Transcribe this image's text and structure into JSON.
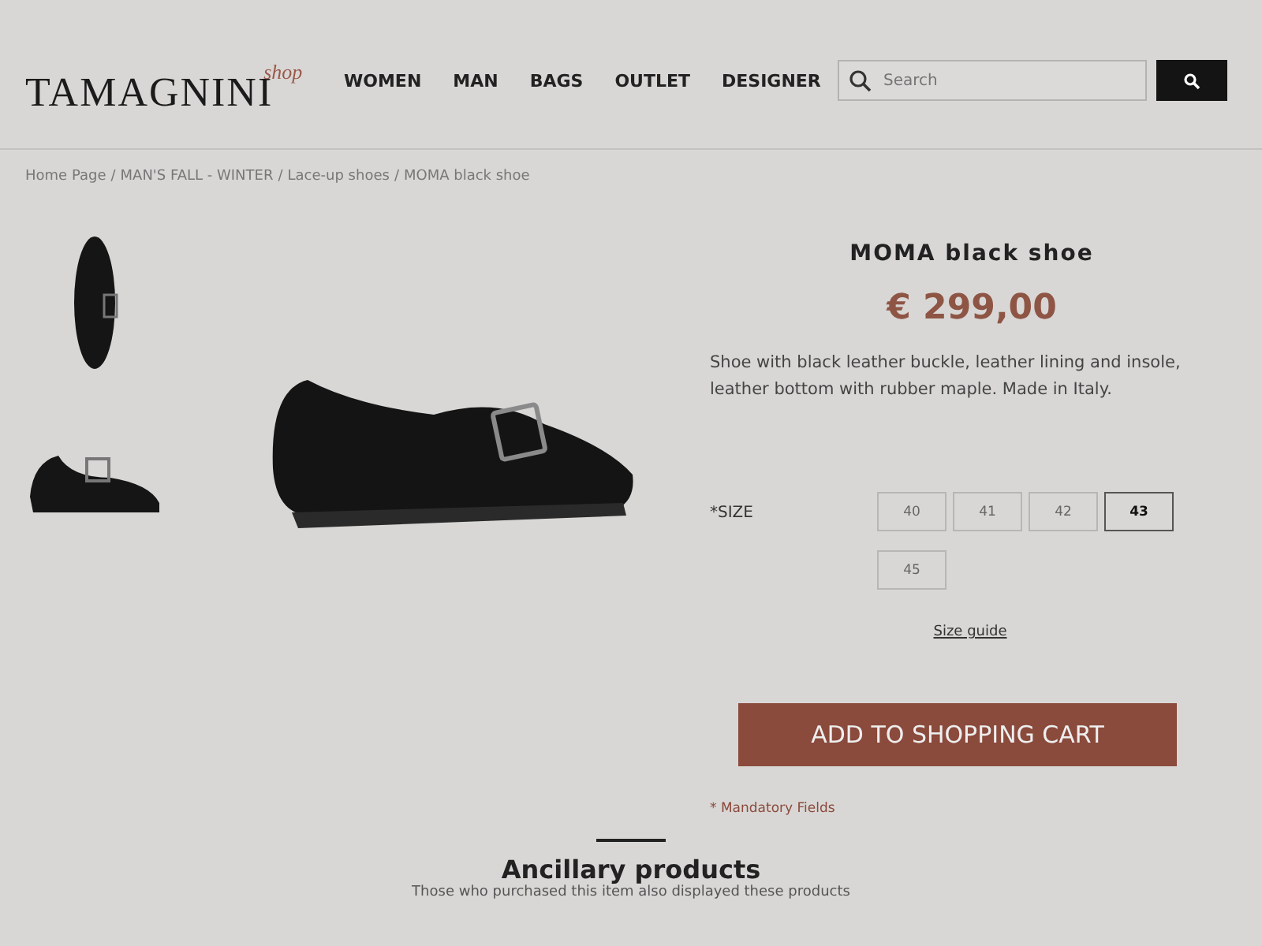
{
  "logo": {
    "name": "TAMAGNINI",
    "tag": "shop"
  },
  "nav": [
    {
      "label": "WOMEN"
    },
    {
      "label": "MAN"
    },
    {
      "label": "BAGS"
    },
    {
      "label": "OUTLET"
    },
    {
      "label": "DESIGNER"
    }
  ],
  "search": {
    "placeholder": "Search"
  },
  "breadcrumb": {
    "separator": "/",
    "items": [
      {
        "label": "Home Page"
      },
      {
        "label": "MAN'S FALL - WINTER"
      },
      {
        "label": "Lace-up shoes"
      },
      {
        "label": "MOMA black shoe"
      }
    ]
  },
  "gallery": {
    "thumbnails": [
      {
        "kind": "top"
      },
      {
        "kind": "side"
      }
    ]
  },
  "product": {
    "title": "MOMA black shoe",
    "price": "€ 299,00",
    "description": "Shoe with black leather buckle, leather lining and insole, leather bottom with rubber maple. Made in Italy.",
    "size_label": "*SIZE",
    "sizes": [
      {
        "label": "40",
        "selected": false
      },
      {
        "label": "41",
        "selected": false
      },
      {
        "label": "42",
        "selected": false
      },
      {
        "label": "43",
        "selected": true
      },
      {
        "label": "45",
        "selected": false
      }
    ],
    "size_guide": "Size guide",
    "add_to_cart": "ADD TO SHOPPING CART",
    "mandatory_note": "* Mandatory Fields"
  },
  "ancillary": {
    "title": "Ancillary products",
    "subtitle": "Those who purchased this item also displayed these products"
  }
}
